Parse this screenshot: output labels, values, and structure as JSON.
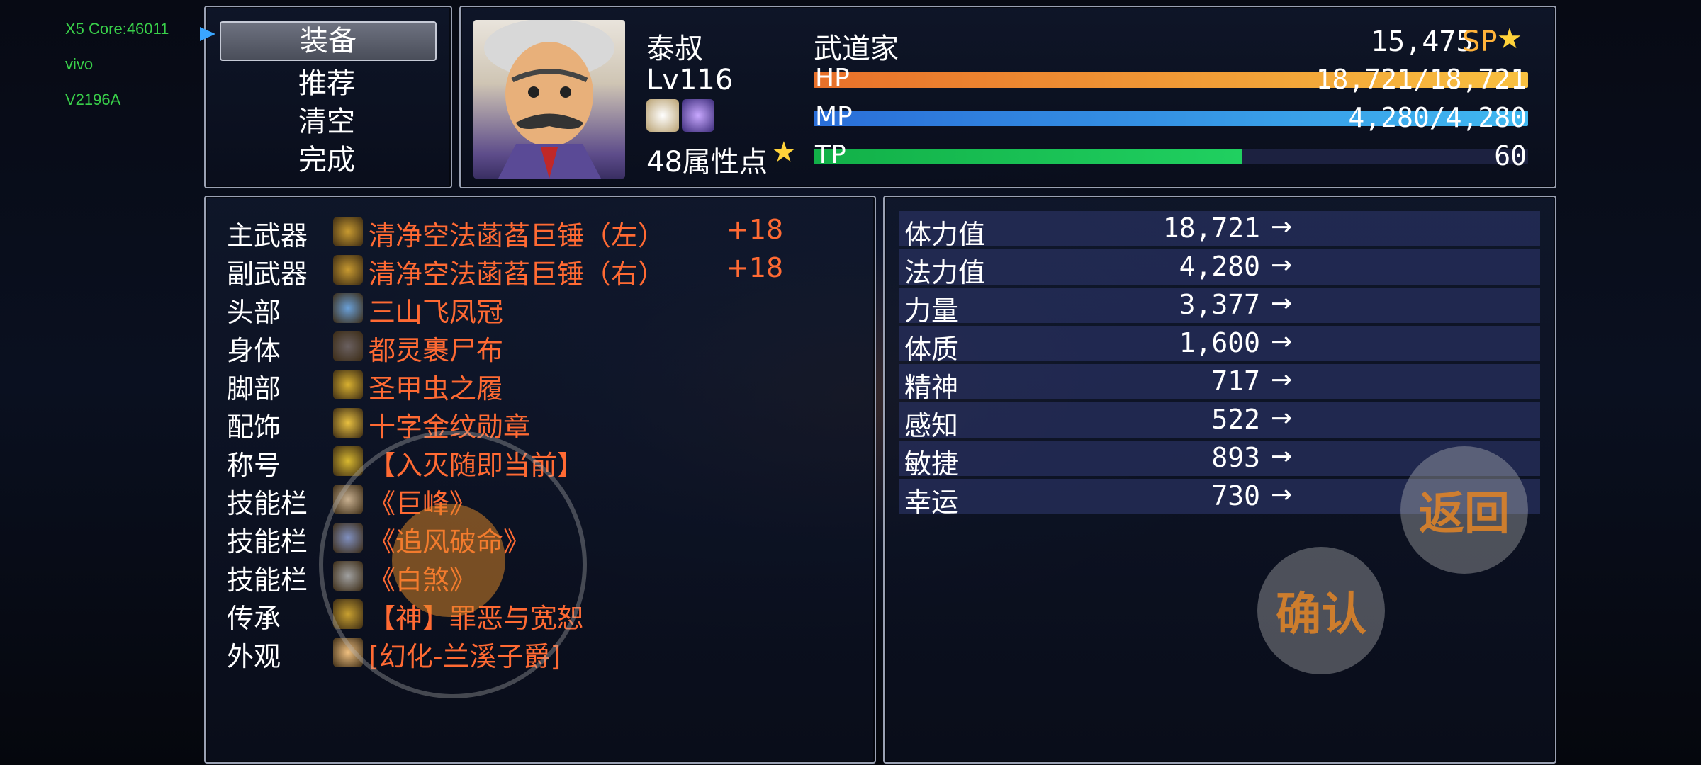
{
  "debug": {
    "core": "X5 Core:46011",
    "brand": "vivo",
    "model": "V2196A"
  },
  "menu": {
    "items": [
      "装备",
      "推荐",
      "清空",
      "完成"
    ],
    "selected": 0
  },
  "character": {
    "name": "泰叔",
    "class": "武道家",
    "level": "Lv116",
    "sp": "15,475",
    "sp_label": "SP",
    "attr_points": "48属性点",
    "hp": {
      "label": "HP",
      "text": "18,721/18,721",
      "fill": 1.0
    },
    "mp": {
      "label": "MP",
      "text": "4,280/4,280",
      "fill": 1.0
    },
    "tp": {
      "label": "TP",
      "text": "60",
      "fill": 0.6
    }
  },
  "equipment": [
    {
      "slot": "主武器",
      "name": "清净空法菡萏巨锤（左）",
      "plus": "+18",
      "icon": "hammer-icon"
    },
    {
      "slot": "副武器",
      "name": "清净空法菡萏巨锤（右）",
      "plus": "+18",
      "icon": "hammer-icon"
    },
    {
      "slot": "头部",
      "name": "三山飞凤冠",
      "plus": "",
      "icon": "crown-icon"
    },
    {
      "slot": "身体",
      "name": "都灵裹尸布",
      "plus": "",
      "icon": "cloth-icon"
    },
    {
      "slot": "脚部",
      "name": "圣甲虫之履",
      "plus": "",
      "icon": "boots-icon"
    },
    {
      "slot": "配饰",
      "name": "十字金纹勋章",
      "plus": "",
      "icon": "cross-icon"
    },
    {
      "slot": "称号",
      "name": "【入灭随即当前】",
      "plus": "",
      "icon": "title-icon"
    },
    {
      "slot": "技能栏",
      "name": "《巨峰》",
      "plus": "",
      "icon": "skill-icon"
    },
    {
      "slot": "技能栏",
      "name": "《追风破命》",
      "plus": "",
      "icon": "wind-icon"
    },
    {
      "slot": "技能栏",
      "name": "《白煞》",
      "plus": "",
      "icon": "scroll-icon"
    },
    {
      "slot": "传承",
      "name": "【神】罪恶与宽恕",
      "plus": "",
      "icon": "inherit-icon"
    },
    {
      "slot": "外观",
      "name": "[幻化-兰溪子爵]",
      "plus": "",
      "icon": "face-icon"
    }
  ],
  "stats": [
    {
      "label": "体力值",
      "value": "18,721"
    },
    {
      "label": "法力值",
      "value": "4,280"
    },
    {
      "label": "力量",
      "value": "3,377"
    },
    {
      "label": "体质",
      "value": "1,600"
    },
    {
      "label": "精神",
      "value": "717"
    },
    {
      "label": "感知",
      "value": "522"
    },
    {
      "label": "敏捷",
      "value": "893"
    },
    {
      "label": "幸运",
      "value": "730"
    }
  ],
  "arrow": "→",
  "buttons": {
    "back": "返回",
    "confirm": "确认"
  },
  "colors": {
    "equip_name": "#ff6a33",
    "hp_bar": "#f0a030",
    "mp_bar": "#3aa0e8",
    "tp_bar": "#18c050"
  }
}
